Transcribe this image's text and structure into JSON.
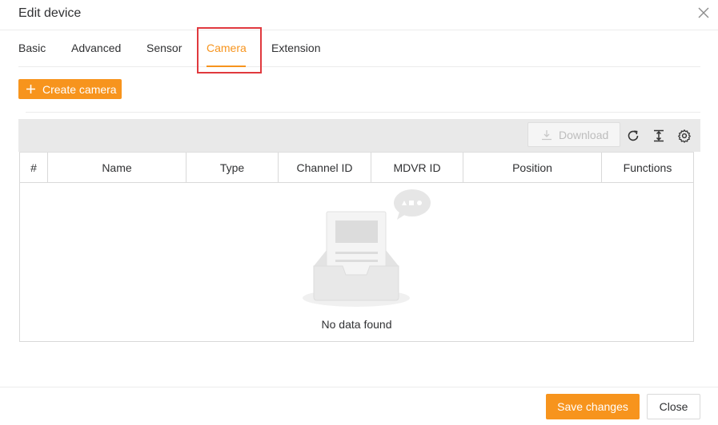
{
  "dialog": {
    "title": "Edit device",
    "close_icon": "close-icon"
  },
  "tabs": [
    {
      "label": "Basic",
      "active": false
    },
    {
      "label": "Advanced",
      "active": false
    },
    {
      "label": "Sensor",
      "active": false
    },
    {
      "label": "Camera",
      "active": true
    },
    {
      "label": "Extension",
      "active": false
    }
  ],
  "actions": {
    "create_label": "Create camera",
    "create_icon": "plus-icon"
  },
  "toolbar": {
    "download_label": "Download",
    "download_icon": "download-icon",
    "refresh_icon": "refresh-icon",
    "column_height_icon": "column-height-icon",
    "settings_icon": "gear-icon"
  },
  "table": {
    "columns": [
      "#",
      "Name",
      "Type",
      "Channel ID",
      "MDVR ID",
      "Position",
      "Functions"
    ],
    "rows": [],
    "empty_text": "No data found",
    "empty_icon": "empty-inbox-icon"
  },
  "footer": {
    "save_label": "Save changes",
    "close_label": "Close"
  },
  "colors": {
    "accent": "#f7941d",
    "highlight": "#e0393e"
  }
}
